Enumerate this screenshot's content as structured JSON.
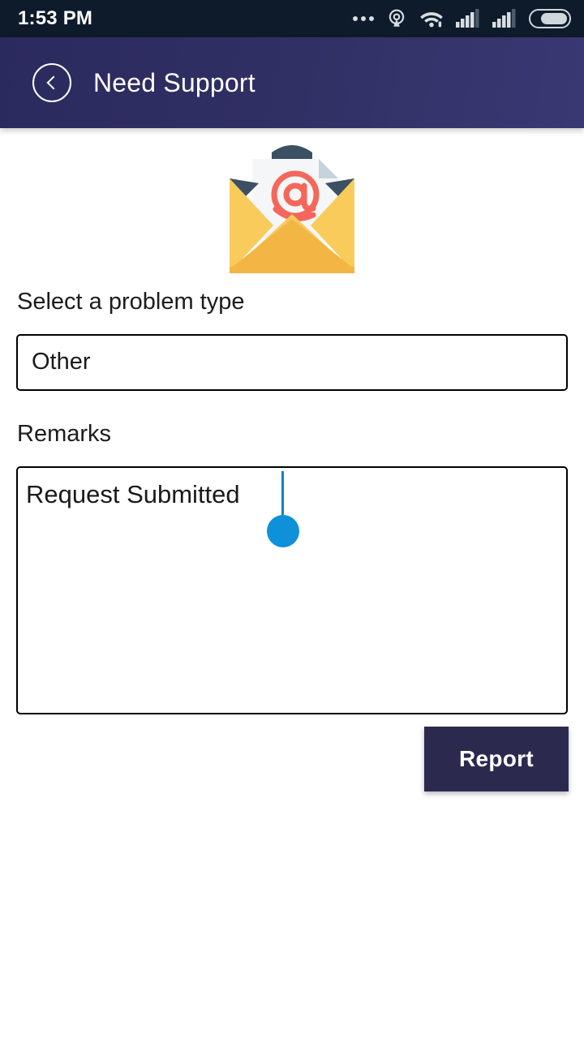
{
  "status_bar": {
    "time": "1:53 PM",
    "icons": [
      {
        "name": "more-dots-icon",
        "label": "..."
      },
      {
        "name": "hotspot-icon",
        "label": "hotspot"
      },
      {
        "name": "wifi-icon",
        "label": "wifi"
      },
      {
        "name": "signal-sim1-icon",
        "label": "signal bars sim 1"
      },
      {
        "name": "signal-sim2-icon",
        "label": "signal bars sim 2"
      },
      {
        "name": "battery-icon",
        "label": "battery"
      }
    ],
    "background_color": "#0d1b2a"
  },
  "app_bar": {
    "title": "Need Support",
    "back_icon": "back-chevron-icon",
    "gradient_start": "#2b2a5e",
    "gradient_end": "#393873"
  },
  "illustration": {
    "name": "open-envelope-email-icon",
    "at_symbol": "@",
    "envelope_body_color": "#F9CB5B",
    "envelope_front_color": "#F3B544",
    "envelope_flap_color": "#3C5063",
    "letter_color": "#F4F6F7",
    "at_color": "#F4675A"
  },
  "form": {
    "problem_type": {
      "label": "Select a problem type",
      "selected_value": "Other"
    },
    "remarks": {
      "label": "Remarks",
      "value": "Request Submitted",
      "placeholder": ""
    }
  },
  "actions": {
    "report_button": {
      "label": "Report",
      "background_color": "#2b2a4e",
      "text_color": "#ffffff"
    }
  }
}
